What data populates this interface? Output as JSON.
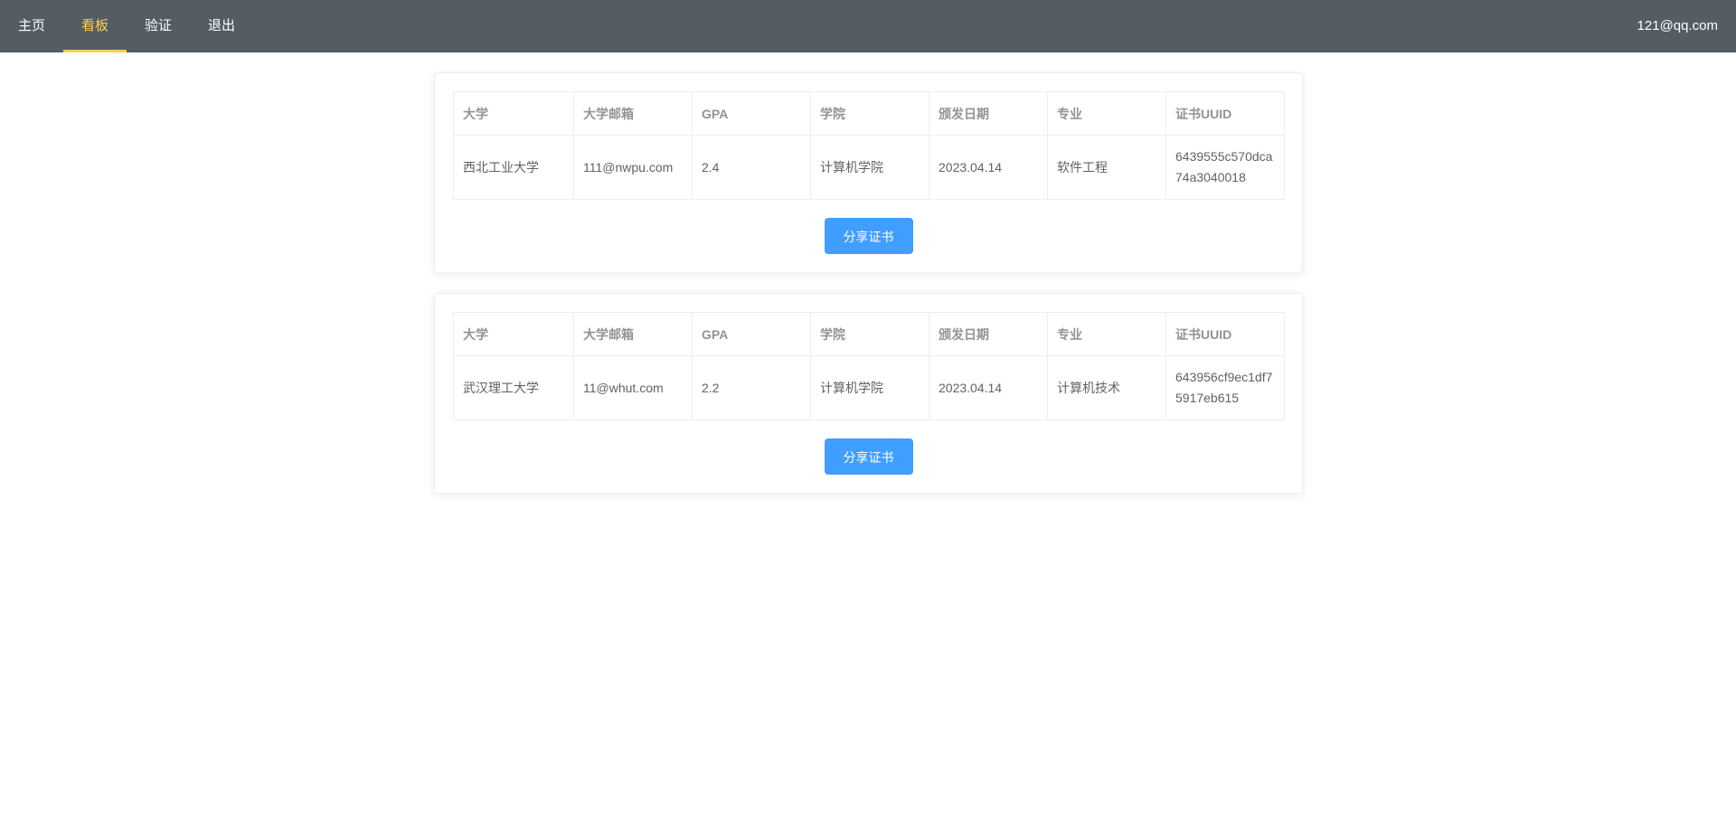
{
  "nav": {
    "items": [
      {
        "label": "主页",
        "active": false
      },
      {
        "label": "看板",
        "active": true
      },
      {
        "label": "验证",
        "active": false
      },
      {
        "label": "退出",
        "active": false
      }
    ],
    "user_email": "121@qq.com"
  },
  "table_headers": [
    "大学",
    "大学邮箱",
    "GPA",
    "学院",
    "颁发日期",
    "专业",
    "证书UUID"
  ],
  "certificates": [
    {
      "university": "西北工业大学",
      "email": "111@nwpu.com",
      "gpa": "2.4",
      "college": "计算机学院",
      "issue_date": "2023.04.14",
      "major": "软件工程",
      "uuid": "6439555c570dca74a3040018",
      "share_label": "分享证书"
    },
    {
      "university": "武汉理工大学",
      "email": "11@whut.com",
      "gpa": "2.2",
      "college": "计算机学院",
      "issue_date": "2023.04.14",
      "major": "计算机技术",
      "uuid": "643956cf9ec1df75917eb615",
      "share_label": "分享证书"
    }
  ],
  "colors": {
    "navbar_bg": "#545c64",
    "nav_active": "#ffd04b",
    "primary_button": "#409eff"
  }
}
